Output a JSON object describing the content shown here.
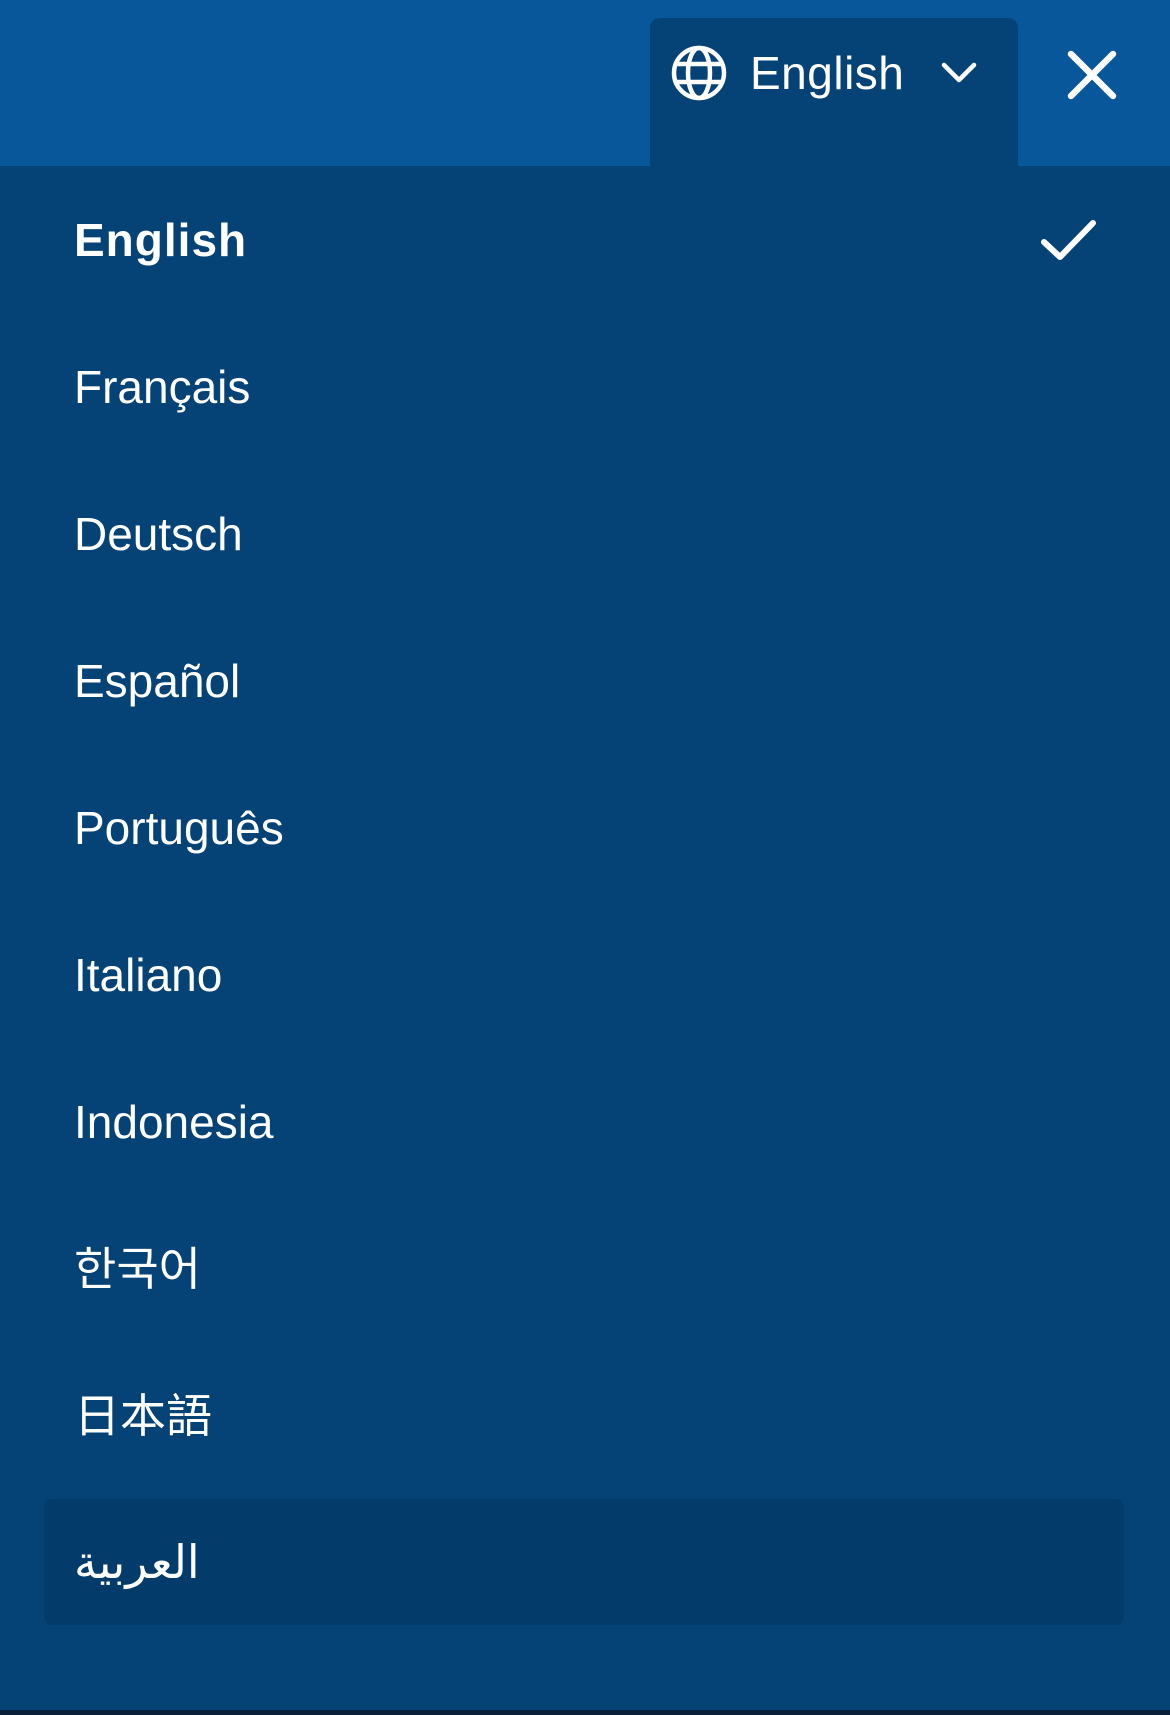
{
  "header": {
    "language_toggle_label": "English"
  },
  "languages": [
    {
      "label": "English",
      "selected": true
    },
    {
      "label": "Français",
      "selected": false
    },
    {
      "label": "Deutsch",
      "selected": false
    },
    {
      "label": "Español",
      "selected": false
    },
    {
      "label": "Português",
      "selected": false
    },
    {
      "label": "Italiano",
      "selected": false
    },
    {
      "label": "Indonesia",
      "selected": false
    },
    {
      "label": "한국어",
      "selected": false
    },
    {
      "label": "日本語",
      "selected": false
    },
    {
      "label": "العربية",
      "selected": false
    }
  ],
  "icons": {
    "globe": "globe-icon",
    "chevron": "chevron-down-icon",
    "close": "close-icon",
    "check": "checkmark-icon"
  },
  "colors": {
    "header_bg": "#07579a",
    "panel_bg": "#054275",
    "hover_row_bg": "#033c6b",
    "text": "#ffffff"
  }
}
